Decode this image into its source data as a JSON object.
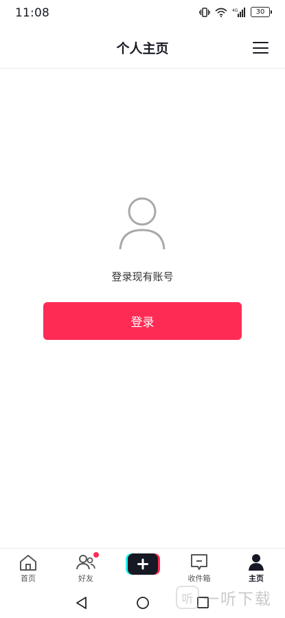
{
  "status_bar": {
    "time": "11:08",
    "battery": "30"
  },
  "header": {
    "title": "个人主页"
  },
  "login": {
    "prompt": "登录现有账号",
    "button_label": "登录"
  },
  "bottom_nav": {
    "items": [
      {
        "label": "首页",
        "icon": "home-icon"
      },
      {
        "label": "好友",
        "icon": "friends-icon"
      },
      {
        "label": "",
        "icon": "add-icon"
      },
      {
        "label": "收件箱",
        "icon": "inbox-icon"
      },
      {
        "label": "主页",
        "icon": "profile-icon"
      }
    ],
    "active": "主页",
    "badge_color": "#fe2c55"
  },
  "colors": {
    "accent": "#fe2c55",
    "text": "#161823"
  },
  "watermark": {
    "logo_text": "听",
    "text": "一听下载"
  }
}
